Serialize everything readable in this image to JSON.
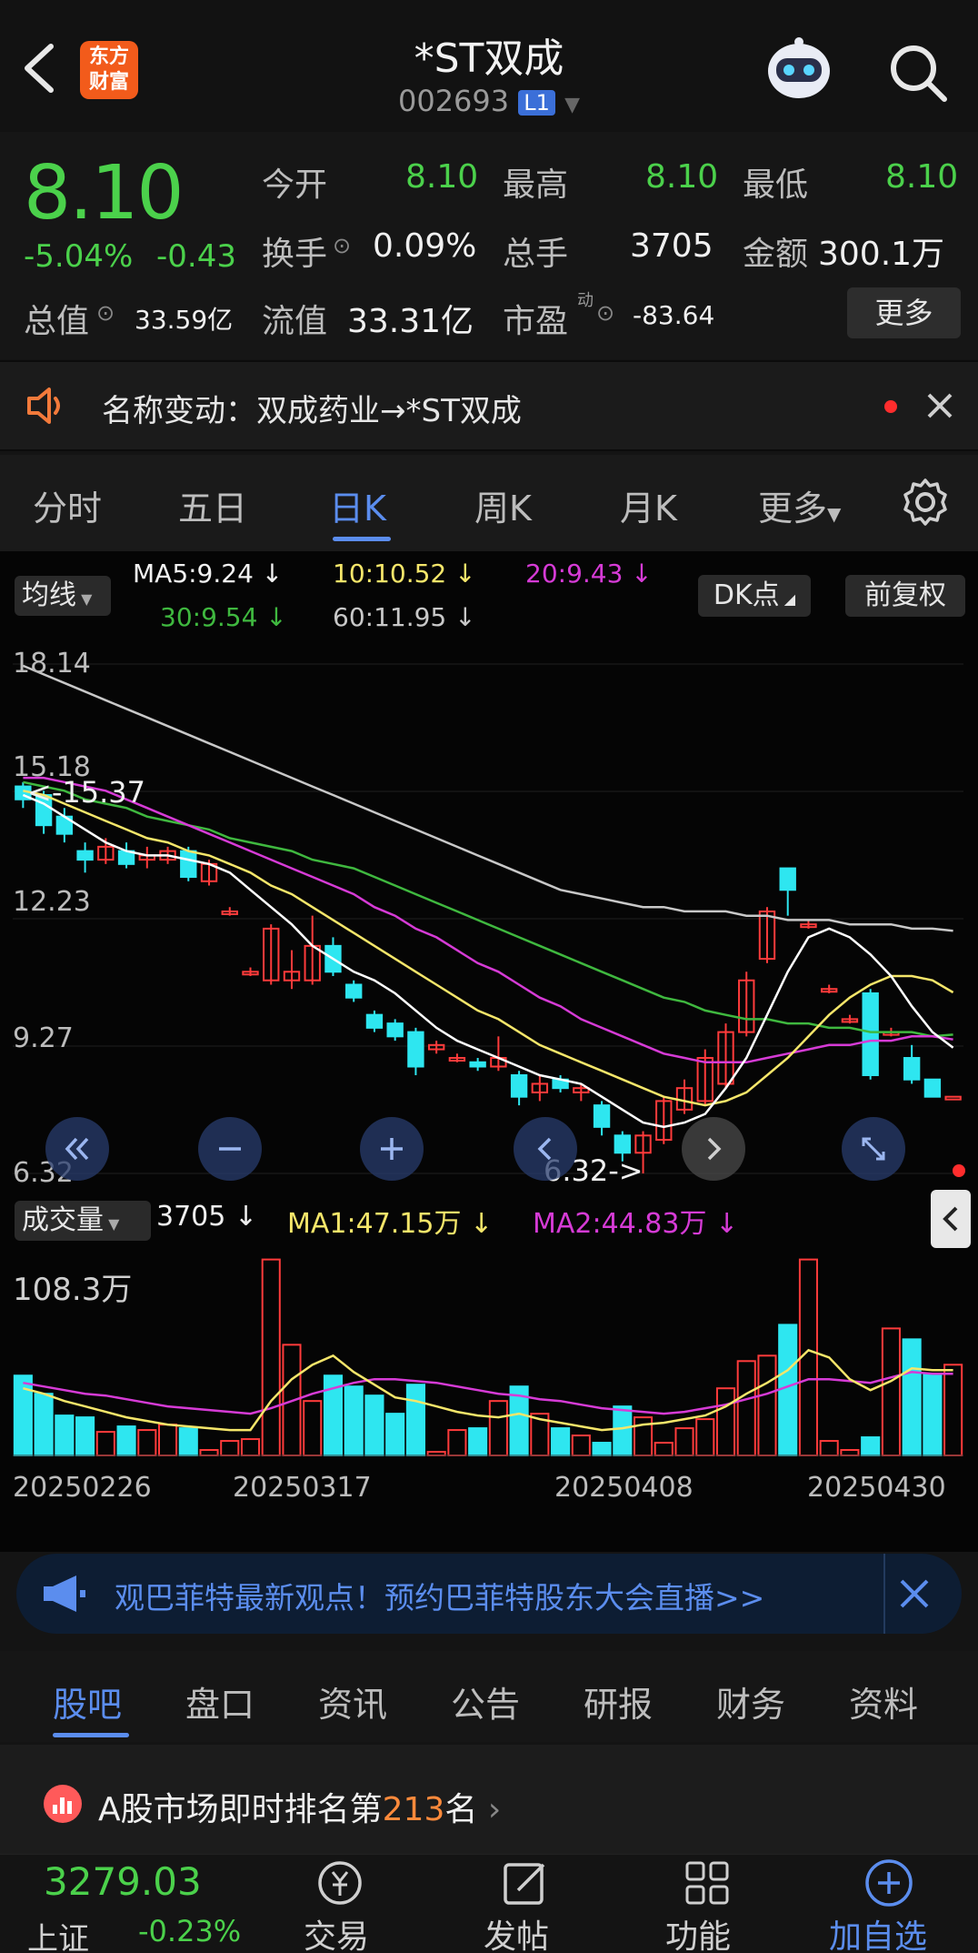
{
  "header": {
    "title": "*ST双成",
    "code": "002693",
    "level_badge": "L1",
    "logo_line1": "东方",
    "logo_line2": "财富"
  },
  "quote": {
    "price": "8.10",
    "change_pct": "-5.04%",
    "change": "-0.43",
    "open_label": "今开",
    "open": "8.10",
    "high_label": "最高",
    "high": "8.10",
    "low_label": "最低",
    "low": "8.10",
    "turnover_label": "换手",
    "turnover": "0.09%",
    "volume_label": "总手",
    "volume": "3705",
    "amount_label": "金额",
    "amount": "300.1万",
    "mktcap_label": "总值",
    "mktcap": "33.59亿",
    "float_label": "流值",
    "float_cap": "33.31亿",
    "pe_label": "市盈",
    "pe_sup": "动",
    "pe": "-83.64",
    "more_label": "更多"
  },
  "notice": {
    "text": "名称变动：双成药业→*ST双成"
  },
  "period_tabs": [
    "分时",
    "五日",
    "日K",
    "周K",
    "月K",
    "更多"
  ],
  "kline": {
    "ma_toggle": "均线",
    "ma5": "MA5:9.24 ↓",
    "ma10": "10:10.52 ↓",
    "ma20": "20:9.43 ↓",
    "ma30": "30:9.54 ↓",
    "ma60": "60:11.95 ↓",
    "dk_label": "DK点",
    "adjust_label": "前复权",
    "y_labels": [
      "18.14",
      "15.18",
      "12.23",
      "9.27",
      "6.32"
    ],
    "high_marker": "<-15.37",
    "low_marker": "6.32->"
  },
  "volume": {
    "toggle": "成交量",
    "value": "3705 ↓",
    "ma1": "MA1:47.15万 ↓",
    "ma2": "MA2:44.83万 ↓",
    "max_label": "108.3万",
    "x_labels": [
      "20250226",
      "20250317",
      "20250408",
      "20250430"
    ]
  },
  "colors": {
    "up": "#ff3b3b",
    "down": "#2ee6f0",
    "ma5": "#ffffff",
    "ma10": "#f5e66a",
    "ma20": "#d63bd6",
    "ma30": "#3fb83f",
    "ma60": "#c8c8c8",
    "accent": "#5b8dee"
  },
  "banner": {
    "text": "观巴菲特最新观点！预约巴菲特股东大会直播>>"
  },
  "section_tabs": [
    "股吧",
    "盘口",
    "资讯",
    "公告",
    "研报",
    "财务",
    "资料"
  ],
  "rank": {
    "prefix": "A股市场即时排名第",
    "rank": "213",
    "suffix": "名"
  },
  "bottom": {
    "index_value": "3279.03",
    "index_name": "上证",
    "index_change": "-0.23%",
    "nav": [
      "交易",
      "发帖",
      "功能",
      "加自选"
    ]
  },
  "chart_data": {
    "type": "candlestick",
    "ylim": [
      6.32,
      18.14
    ],
    "candles": [
      {
        "o": 15.3,
        "c": 15.0,
        "h": 15.4,
        "l": 14.8
      },
      {
        "o": 15.1,
        "c": 14.4,
        "h": 15.2,
        "l": 14.2
      },
      {
        "o": 14.6,
        "c": 14.2,
        "h": 14.8,
        "l": 14.0
      },
      {
        "o": 13.8,
        "c": 13.6,
        "h": 14.0,
        "l": 13.3
      },
      {
        "o": 13.6,
        "c": 13.9,
        "h": 14.1,
        "l": 13.5
      },
      {
        "o": 13.8,
        "c": 13.5,
        "h": 14.0,
        "l": 13.4
      },
      {
        "o": 13.6,
        "c": 13.7,
        "h": 13.9,
        "l": 13.4
      },
      {
        "o": 13.6,
        "c": 13.8,
        "h": 13.9,
        "l": 13.5
      },
      {
        "o": 13.8,
        "c": 13.2,
        "h": 13.9,
        "l": 13.1
      },
      {
        "o": 13.1,
        "c": 13.5,
        "h": 13.6,
        "l": 13.0
      },
      {
        "o": 12.4,
        "c": 12.4,
        "h": 12.5,
        "l": 12.3
      },
      {
        "o": 11.0,
        "c": 11.0,
        "h": 11.1,
        "l": 10.9
      },
      {
        "o": 10.8,
        "c": 12.0,
        "h": 12.1,
        "l": 10.7
      },
      {
        "o": 10.8,
        "c": 11.0,
        "h": 11.5,
        "l": 10.6
      },
      {
        "o": 10.8,
        "c": 11.6,
        "h": 12.3,
        "l": 10.7
      },
      {
        "o": 11.6,
        "c": 11.0,
        "h": 11.8,
        "l": 10.9
      },
      {
        "o": 10.7,
        "c": 10.4,
        "h": 10.8,
        "l": 10.3
      },
      {
        "o": 10.0,
        "c": 9.7,
        "h": 10.1,
        "l": 9.6
      },
      {
        "o": 9.8,
        "c": 9.5,
        "h": 9.9,
        "l": 9.4
      },
      {
        "o": 9.6,
        "c": 8.8,
        "h": 9.7,
        "l": 8.6
      },
      {
        "o": 9.2,
        "c": 9.3,
        "h": 9.4,
        "l": 9.1
      },
      {
        "o": 9.0,
        "c": 9.0,
        "h": 9.1,
        "l": 8.9
      },
      {
        "o": 8.9,
        "c": 8.8,
        "h": 9.0,
        "l": 8.7
      },
      {
        "o": 8.8,
        "c": 9.0,
        "h": 9.5,
        "l": 8.7
      },
      {
        "o": 8.6,
        "c": 8.1,
        "h": 8.7,
        "l": 7.9
      },
      {
        "o": 8.2,
        "c": 8.4,
        "h": 8.6,
        "l": 8.0
      },
      {
        "o": 8.5,
        "c": 8.3,
        "h": 8.6,
        "l": 8.2
      },
      {
        "o": 8.2,
        "c": 8.3,
        "h": 8.4,
        "l": 8.0
      },
      {
        "o": 7.9,
        "c": 7.4,
        "h": 8.0,
        "l": 7.2
      },
      {
        "o": 7.2,
        "c": 6.8,
        "h": 7.3,
        "l": 6.6
      },
      {
        "o": 6.8,
        "c": 7.2,
        "h": 7.3,
        "l": 6.32
      },
      {
        "o": 7.1,
        "c": 8.0,
        "h": 8.1,
        "l": 7.0
      },
      {
        "o": 7.8,
        "c": 8.3,
        "h": 8.5,
        "l": 7.7
      },
      {
        "o": 8.0,
        "c": 9.0,
        "h": 9.2,
        "l": 7.9
      },
      {
        "o": 8.4,
        "c": 9.6,
        "h": 9.8,
        "l": 8.3
      },
      {
        "o": 9.6,
        "c": 10.8,
        "h": 11.0,
        "l": 9.5
      },
      {
        "o": 11.3,
        "c": 12.4,
        "h": 12.5,
        "l": 11.2
      },
      {
        "o": 13.4,
        "c": 12.9,
        "h": 13.4,
        "l": 12.3
      },
      {
        "o": 12.1,
        "c": 12.1,
        "h": 12.2,
        "l": 12.0
      },
      {
        "o": 10.6,
        "c": 10.6,
        "h": 10.7,
        "l": 10.5
      },
      {
        "o": 9.9,
        "c": 9.9,
        "h": 10.0,
        "l": 9.8
      },
      {
        "o": 10.5,
        "c": 8.6,
        "h": 10.6,
        "l": 8.5
      },
      {
        "o": 9.6,
        "c": 9.6,
        "h": 9.7,
        "l": 9.5
      },
      {
        "o": 9.0,
        "c": 8.5,
        "h": 9.3,
        "l": 8.4
      },
      {
        "o": 8.5,
        "c": 8.1,
        "h": 8.5,
        "l": 8.1
      },
      {
        "o": 8.1,
        "c": 8.1,
        "h": 8.1,
        "l": 8.1
      }
    ],
    "volume_max_wan": 108.3,
    "volumes_wan": [
      44,
      34,
      22,
      21,
      13,
      16,
      14,
      17,
      15,
      3,
      8,
      9,
      108,
      61,
      30,
      44,
      38,
      33,
      23,
      39,
      2,
      14,
      15,
      30,
      38,
      23,
      15,
      11,
      7,
      27,
      21,
      7,
      15,
      20,
      37,
      52,
      55,
      72,
      108,
      8,
      3,
      10,
      70,
      64,
      45,
      50
    ],
    "ma1_wan": [
      37,
      34,
      30,
      27,
      24,
      21,
      19,
      17,
      16,
      15,
      14,
      14,
      30,
      42,
      50,
      55,
      46,
      39,
      32,
      30,
      27,
      24,
      22,
      21,
      23,
      20,
      18,
      16,
      14,
      15,
      17,
      18,
      20,
      22,
      27,
      34,
      40,
      47,
      58,
      54,
      42,
      36,
      41,
      48,
      47,
      47
    ],
    "ma2_wan": [
      40,
      38,
      36,
      34,
      33,
      31,
      29,
      27,
      26,
      25,
      24,
      23,
      26,
      30,
      34,
      37,
      40,
      42,
      42,
      41,
      40,
      38,
      36,
      34,
      33,
      31,
      30,
      28,
      26,
      25,
      24,
      23,
      24,
      26,
      28,
      31,
      34,
      38,
      42,
      42,
      41,
      40,
      43,
      46,
      45,
      45
    ],
    "ma5": [
      15.1,
      14.9,
      14.6,
      14.3,
      14.0,
      13.8,
      13.7,
      13.7,
      13.6,
      13.5,
      13.3,
      12.9,
      12.5,
      12.1,
      11.6,
      11.3,
      11.0,
      10.8,
      10.5,
      10.1,
      9.7,
      9.4,
      9.2,
      9.0,
      8.8,
      8.6,
      8.5,
      8.4,
      8.1,
      7.8,
      7.5,
      7.4,
      7.5,
      7.7,
      8.3,
      9.0,
      10.0,
      11.0,
      11.8,
      12.0,
      11.8,
      11.4,
      10.9,
      10.2,
      9.6,
      9.24
    ],
    "ma10": [
      15.2,
      15.1,
      14.9,
      14.7,
      14.5,
      14.3,
      14.1,
      14.0,
      13.8,
      13.7,
      13.5,
      13.3,
      13.0,
      12.8,
      12.5,
      12.2,
      11.9,
      11.6,
      11.3,
      11.0,
      10.7,
      10.4,
      10.1,
      9.9,
      9.6,
      9.3,
      9.1,
      8.9,
      8.7,
      8.5,
      8.3,
      8.1,
      8.0,
      7.9,
      8.0,
      8.2,
      8.6,
      9.0,
      9.5,
      10.0,
      10.4,
      10.7,
      10.9,
      10.9,
      10.8,
      10.52
    ],
    "ma20": [
      15.5,
      15.5,
      15.4,
      15.3,
      15.2,
      15.0,
      14.8,
      14.6,
      14.4,
      14.2,
      14.0,
      13.8,
      13.6,
      13.4,
      13.2,
      13.0,
      12.8,
      12.5,
      12.3,
      12.0,
      11.8,
      11.5,
      11.2,
      11.0,
      10.7,
      10.4,
      10.2,
      9.9,
      9.7,
      9.5,
      9.3,
      9.1,
      9.0,
      8.9,
      8.9,
      8.9,
      9.0,
      9.1,
      9.2,
      9.3,
      9.3,
      9.4,
      9.4,
      9.5,
      9.5,
      9.43
    ],
    "ma30": [
      15.4,
      15.3,
      15.2,
      15.0,
      14.9,
      14.8,
      14.6,
      14.5,
      14.4,
      14.3,
      14.1,
      14.0,
      13.9,
      13.8,
      13.6,
      13.5,
      13.4,
      13.2,
      13.0,
      12.8,
      12.6,
      12.4,
      12.2,
      12.0,
      11.8,
      11.6,
      11.4,
      11.2,
      11.0,
      10.8,
      10.6,
      10.4,
      10.3,
      10.1,
      10.0,
      9.9,
      9.9,
      9.8,
      9.8,
      9.7,
      9.7,
      9.6,
      9.6,
      9.6,
      9.5,
      9.54
    ],
    "ma60": [
      18.1,
      17.9,
      17.7,
      17.5,
      17.3,
      17.1,
      16.9,
      16.7,
      16.5,
      16.3,
      16.1,
      15.9,
      15.7,
      15.5,
      15.3,
      15.1,
      14.9,
      14.7,
      14.5,
      14.3,
      14.1,
      13.9,
      13.7,
      13.5,
      13.3,
      13.1,
      12.9,
      12.8,
      12.7,
      12.6,
      12.5,
      12.5,
      12.4,
      12.4,
      12.4,
      12.3,
      12.3,
      12.2,
      12.2,
      12.2,
      12.1,
      12.1,
      12.1,
      12.0,
      12.0,
      11.95
    ]
  }
}
